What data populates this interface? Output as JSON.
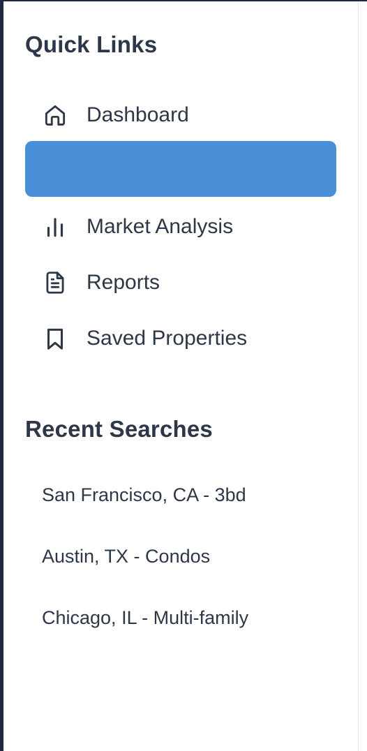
{
  "quick_links": {
    "title": "Quick Links",
    "items": [
      {
        "label": "Dashboard",
        "icon": "home-icon"
      },
      {
        "label": "",
        "icon": "",
        "active": true
      },
      {
        "label": "Market Analysis",
        "icon": "bar-chart-icon"
      },
      {
        "label": "Reports",
        "icon": "document-icon"
      },
      {
        "label": "Saved Properties",
        "icon": "bookmark-icon"
      }
    ]
  },
  "recent_searches": {
    "title": "Recent Searches",
    "items": [
      "San Francisco, CA - 3bd",
      "Austin, TX - Condos",
      "Chicago, IL - Multi-family"
    ]
  },
  "colors": {
    "active_bg": "#4a90d9",
    "text": "#2d3748",
    "frame": "#1e293b"
  }
}
